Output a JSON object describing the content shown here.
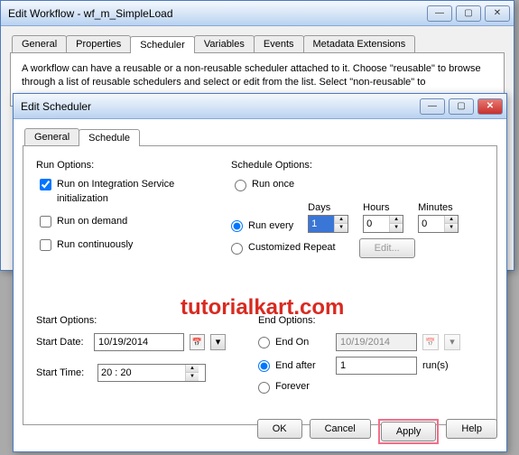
{
  "parent_window": {
    "title": "Edit Workflow - wf_m_SimpleLoad",
    "tabs": [
      "General",
      "Properties",
      "Scheduler",
      "Variables",
      "Events",
      "Metadata Extensions"
    ],
    "active_tab_index": 2,
    "body_text": "A workflow can have a reusable or a non-reusable scheduler attached to it.  Choose \"reusable\" to browse through a list of reusable schedulers and select or edit from the list.  Select \"non-reusable\" to"
  },
  "scheduler_window": {
    "title": "Edit Scheduler",
    "tabs": [
      "General",
      "Schedule"
    ],
    "active_tab_index": 1,
    "run_options": {
      "label": "Run Options:",
      "integration_service": {
        "label": "Run on Integration Service initialization",
        "checked": true
      },
      "on_demand": {
        "label": "Run on demand",
        "checked": false
      },
      "continuously": {
        "label": "Run continuously",
        "checked": false
      }
    },
    "schedule_options": {
      "label": "Schedule Options:",
      "run_once": {
        "label": "Run once",
        "selected": false
      },
      "run_every": {
        "label": "Run every",
        "selected": true,
        "days_label": "Days",
        "days": "1",
        "hours_label": "Hours",
        "hours": "0",
        "minutes_label": "Minutes",
        "minutes": "0"
      },
      "custom": {
        "label": "Customized Repeat",
        "selected": false,
        "edit_btn": "Edit..."
      }
    },
    "start_options": {
      "label": "Start Options:",
      "start_date_label": "Start Date:",
      "start_date": "10/19/2014",
      "start_time_label": "Start Time:",
      "start_time": "20 : 20"
    },
    "end_options": {
      "label": "End Options:",
      "end_on": {
        "label": "End On",
        "selected": false,
        "date": "10/19/2014"
      },
      "end_after": {
        "label": "End after",
        "selected": true,
        "runs": "1",
        "suffix": "run(s)"
      },
      "forever": {
        "label": "Forever",
        "selected": false
      }
    },
    "buttons": {
      "ok": "OK",
      "cancel": "Cancel",
      "apply": "Apply",
      "help": "Help"
    }
  },
  "watermark": "tutorialkart.com"
}
